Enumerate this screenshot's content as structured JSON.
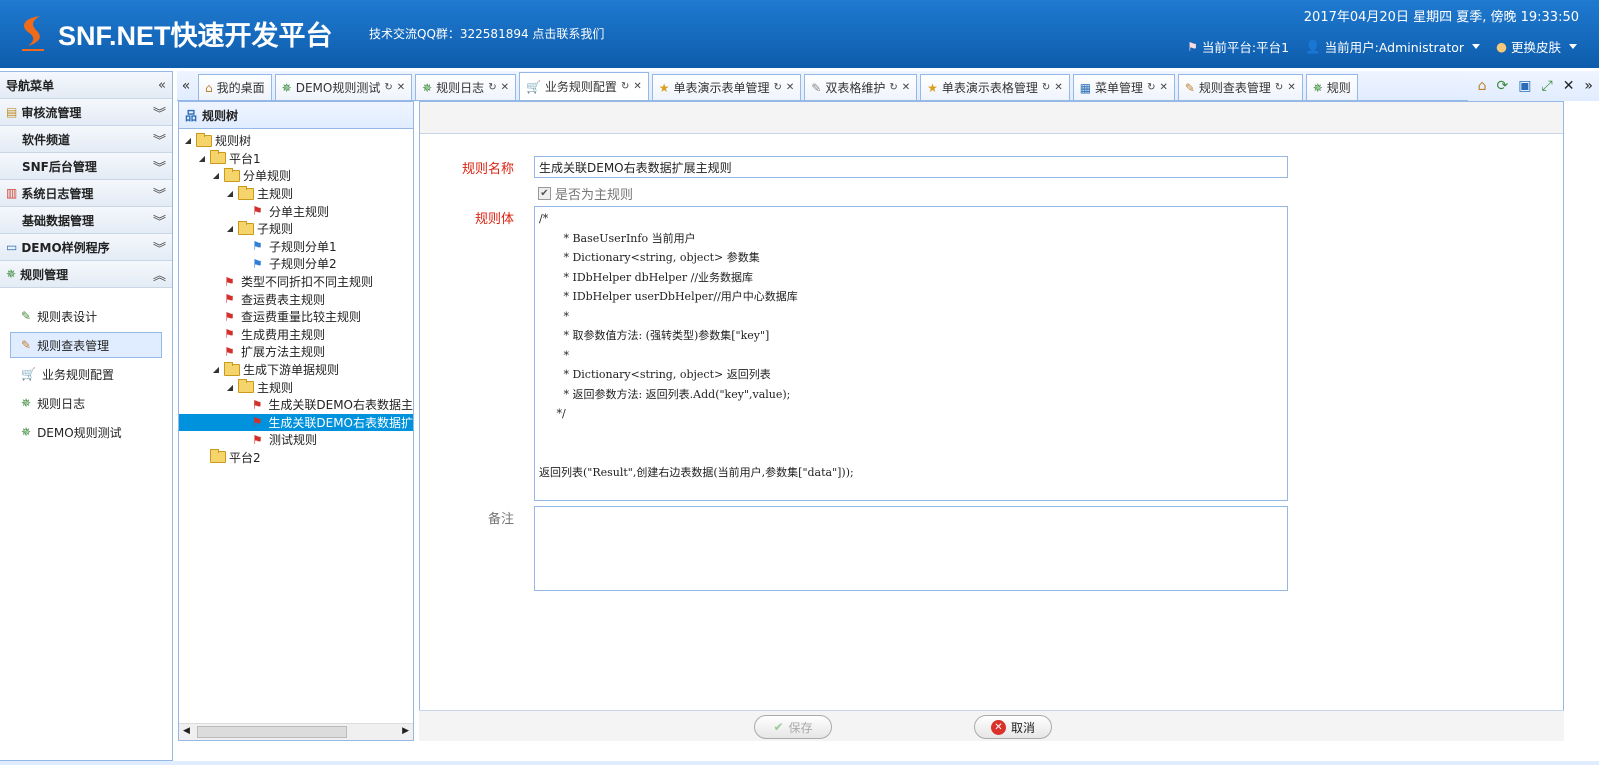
{
  "header": {
    "brand": "SNF.NET快速开发平台",
    "qq_text": "技术交流QQ群：322581894 点击联系我们",
    "datetime": "2017年04月20日 星期四 夏季, 傍晚 19:33:50",
    "platform": "当前平台:平台1",
    "user": "当前用户:Administrator",
    "skin": "更换皮肤"
  },
  "menu": {
    "title": "导航菜单",
    "sections": [
      {
        "label": "审核流管理",
        "icon": "workflow-icon"
      },
      {
        "label": "软件频道",
        "icon": ""
      },
      {
        "label": "SNF后台管理",
        "icon": ""
      },
      {
        "label": "系统日志管理",
        "icon": "chart-icon"
      },
      {
        "label": "基础数据管理",
        "icon": ""
      },
      {
        "label": "DEMO样例程序",
        "icon": "window-icon"
      },
      {
        "label": "规则管理",
        "icon": "rule-icon"
      }
    ],
    "subitems": [
      {
        "label": "规则表设计",
        "selected": false
      },
      {
        "label": "规则查表管理",
        "selected": true
      },
      {
        "label": "业务规则配置",
        "selected": false
      },
      {
        "label": "规则日志",
        "selected": false
      },
      {
        "label": "DEMO规则测试",
        "selected": false
      }
    ]
  },
  "tabs": [
    {
      "label": "我的桌面",
      "closable": false,
      "active": false
    },
    {
      "label": "DEMO规则测试",
      "closable": true,
      "active": false
    },
    {
      "label": "规则日志",
      "closable": true,
      "active": false
    },
    {
      "label": "业务规则配置",
      "closable": true,
      "active": true
    },
    {
      "label": "单表演示表单管理",
      "closable": true,
      "active": false
    },
    {
      "label": "双表格维护",
      "closable": true,
      "active": false
    },
    {
      "label": "单表演示表格管理",
      "closable": true,
      "active": false
    },
    {
      "label": "菜单管理",
      "closable": true,
      "active": false
    },
    {
      "label": "规则查表管理",
      "closable": true,
      "active": false
    },
    {
      "label": "规则",
      "closable": false,
      "active": false
    }
  ],
  "tree": {
    "title": "规则树",
    "nodes": [
      {
        "label": "规则树",
        "level": 0,
        "type": "folder",
        "toggle": "▲"
      },
      {
        "label": "平台1",
        "level": 1,
        "type": "folder",
        "toggle": "▲"
      },
      {
        "label": "分单规则",
        "level": 2,
        "type": "folder",
        "toggle": "▲"
      },
      {
        "label": "主规则",
        "level": 3,
        "type": "folder",
        "toggle": "▲"
      },
      {
        "label": "分单主规则",
        "level": 4,
        "type": "red",
        "toggle": ""
      },
      {
        "label": "子规则",
        "level": 3,
        "type": "folder",
        "toggle": "▲"
      },
      {
        "label": "子规则分单1",
        "level": 4,
        "type": "blue",
        "toggle": ""
      },
      {
        "label": "子规则分单2",
        "level": 4,
        "type": "blue",
        "toggle": ""
      },
      {
        "label": "类型不同折扣不同主规则",
        "level": 2,
        "type": "red",
        "toggle": ""
      },
      {
        "label": "查运费表主规则",
        "level": 2,
        "type": "red",
        "toggle": ""
      },
      {
        "label": "查运费重量比较主规则",
        "level": 2,
        "type": "red",
        "toggle": ""
      },
      {
        "label": "生成费用主规则",
        "level": 2,
        "type": "red",
        "toggle": ""
      },
      {
        "label": "扩展方法主规则",
        "level": 2,
        "type": "red",
        "toggle": ""
      },
      {
        "label": "生成下游单据规则",
        "level": 2,
        "type": "folder",
        "toggle": "▲"
      },
      {
        "label": "主规则",
        "level": 3,
        "type": "folder",
        "toggle": "▲"
      },
      {
        "label": "生成关联DEMO右表数据主",
        "level": 4,
        "type": "red",
        "toggle": ""
      },
      {
        "label": "生成关联DEMO右表数据扩",
        "level": 4,
        "type": "red",
        "toggle": "",
        "selected": true
      },
      {
        "label": "测试规则",
        "level": 4,
        "type": "red",
        "toggle": ""
      },
      {
        "label": "平台2",
        "level": 1,
        "type": "folder",
        "toggle": ""
      }
    ]
  },
  "form": {
    "rule_name_label": "规则名称",
    "rule_name_value": "生成关联DEMO右表数据扩展主规则",
    "is_main_label": "是否为主规则",
    "is_main_checked": true,
    "rule_body_label": "规则体",
    "rule_body_value": "/*\n       * BaseUserInfo 当前用户\n       * Dictionary<string, object> 参数集\n       * IDbHelper dbHelper //业务数据库\n       * IDbHelper userDbHelper//用户中心数据库\n       *\n       * 取参数值方法: (强转类型)参数集[\"key\"]\n       *\n       * Dictionary<string, object> 返回列表\n       * 返回参数方法: 返回列表.Add(\"key\",value);\n     */\n\n\n返回列表(\"Result\",创建右边表数据(当前用户,参数集[\"data\"]));",
    "remark_label": "备注",
    "remark_value": "",
    "save_label": "保存",
    "cancel_label": "取消"
  },
  "colors": {
    "header_top": "#1f7ad0",
    "accent_border": "#95b8e7",
    "tree_selected": "#0092dc",
    "required_label": "#dd2211"
  }
}
